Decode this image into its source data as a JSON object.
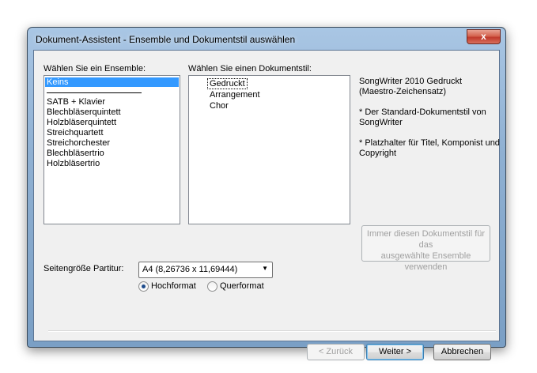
{
  "window": {
    "title": "Dokument-Assistent - Ensemble und Dokumentstil auswählen",
    "close_label": "x"
  },
  "ensemble": {
    "label": "Wählen Sie ein Ensemble:",
    "items": [
      "Keins",
      "SATB + Klavier",
      "Blechbläserquintett",
      "Holzbläserquintett",
      "Streichquartett",
      "Streichorchester",
      "Blechbläsertrio",
      "Holzbläsertrio"
    ],
    "selected": "Keins"
  },
  "docstyle": {
    "label": "Wählen Sie einen Dokumentstil:",
    "items": [
      "Gedruckt",
      "Arrangement",
      "Chor"
    ],
    "selected": "Gedruckt"
  },
  "description": {
    "line1": "SongWriter 2010 Gedruckt",
    "line2": "(Maestro-Zeichensatz)",
    "note1a": "* Der Standard-Dokumentstil von",
    "note1b": "SongWriter",
    "note2a": "* Platzhalter für Titel, Komponist und",
    "note2b": "Copyright"
  },
  "always_button": {
    "line1": "Immer diesen Dokumentstil für das",
    "line2": "ausgewählte Ensemble",
    "line3": "verwenden"
  },
  "pagesize": {
    "label": "Seitengröße Partitur:",
    "value": "A4 (8,26736 x 11,69444)"
  },
  "orientation": {
    "portrait": "Hochformat",
    "landscape": "Querformat",
    "selected": "portrait"
  },
  "buttons": {
    "back": "< Zurück",
    "next": "Weiter >",
    "cancel": "Abbrechen"
  }
}
